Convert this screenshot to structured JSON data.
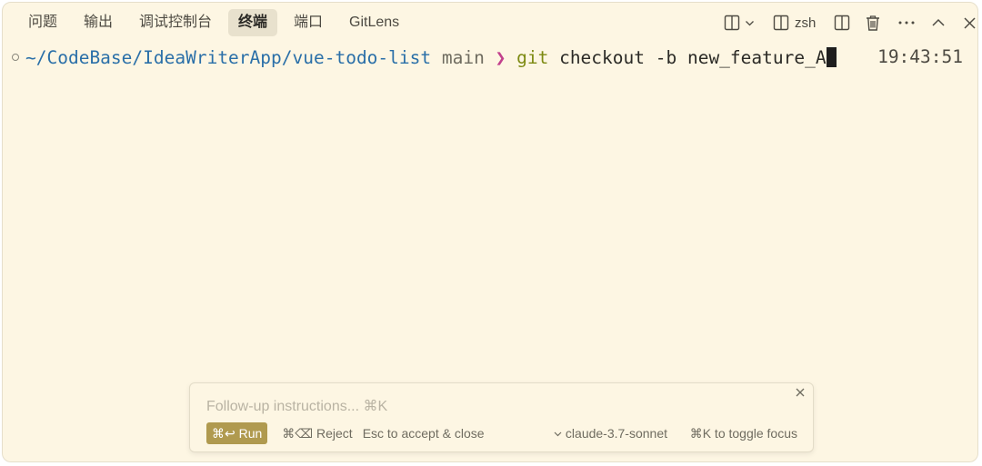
{
  "tabs": [
    {
      "label": "问题",
      "active": false
    },
    {
      "label": "输出",
      "active": false
    },
    {
      "label": "调试控制台",
      "active": false
    },
    {
      "label": "终端",
      "active": true
    },
    {
      "label": "端口",
      "active": false
    },
    {
      "label": "GitLens",
      "active": false
    }
  ],
  "toolbar": {
    "shell_label": "zsh",
    "icons": [
      "split-layout-icon",
      "chevron-down-icon",
      "terminal-split-icon",
      "split-editor-icon",
      "trash-icon",
      "more-icon",
      "chevron-up-icon",
      "close-icon"
    ]
  },
  "terminal": {
    "path": "~/CodeBase/IdeaWriterApp/vue-todo-list",
    "branch": "main",
    "prompt_symbol": "❯",
    "command": "git",
    "args": "checkout -b new_feature_A",
    "time": "19:43:51"
  },
  "inline_prompt": {
    "placeholder": "Follow-up instructions... ⌘K",
    "run_label": "⌘↩ Run",
    "reject_label": "⌘⌫ Reject",
    "accept_label": "Esc to accept & close",
    "model_label": "claude-3.7-sonnet",
    "toggle_focus_label": "⌘K to toggle focus"
  },
  "colors": {
    "background": "#fdf6e3",
    "path": "#2a6fa8",
    "prompt_symbol": "#c2418d",
    "git": "#7d8a12",
    "run_button": "#b09a4f"
  }
}
